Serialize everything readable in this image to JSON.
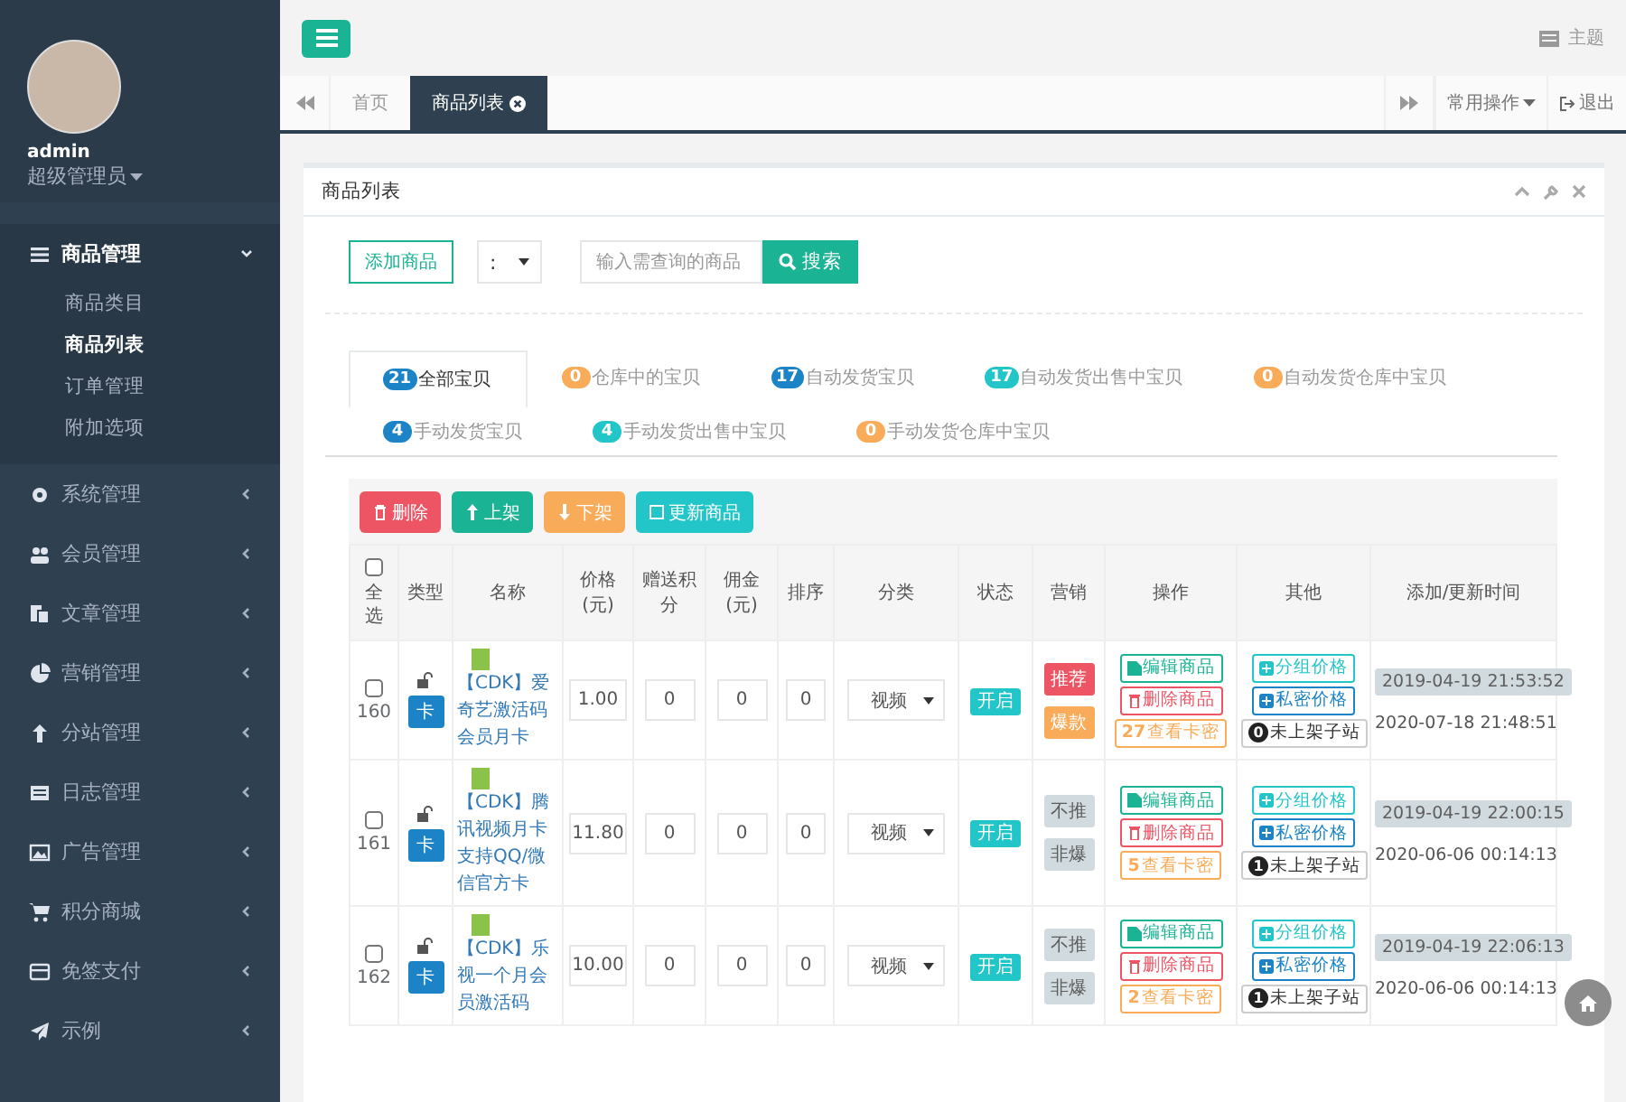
{
  "sidebar": {
    "user": {
      "name": "admin",
      "role": "超级管理员"
    },
    "menu": [
      {
        "label": "商品管理",
        "expanded": true,
        "children": [
          {
            "label": "商品类目",
            "selected": false
          },
          {
            "label": "商品列表",
            "selected": true
          },
          {
            "label": "订单管理",
            "selected": false
          },
          {
            "label": "附加选项",
            "selected": false
          }
        ]
      },
      {
        "label": "系统管理",
        "expanded": false
      },
      {
        "label": "会员管理",
        "expanded": false
      },
      {
        "label": "文章管理",
        "expanded": false
      },
      {
        "label": "营销管理",
        "expanded": false
      },
      {
        "label": "分站管理",
        "expanded": false
      },
      {
        "label": "日志管理",
        "expanded": false
      },
      {
        "label": "广告管理",
        "expanded": false
      },
      {
        "label": "积分商城",
        "expanded": false
      },
      {
        "label": "免签支付",
        "expanded": false
      },
      {
        "label": "示例",
        "expanded": false
      }
    ]
  },
  "topbar": {
    "theme_label": "主题"
  },
  "page_tabs": [
    {
      "label": "首页",
      "selected": false
    },
    {
      "label": "商品列表",
      "selected": true
    }
  ],
  "tab_actions": {
    "common_ops": "常用操作",
    "logout": "退出"
  },
  "panel": {
    "title": "商品列表",
    "add_button": "添加商品",
    "filter_select": ":",
    "search": {
      "placeholder": "输入需查询的商品"
    },
    "search_button": "搜索",
    "status_tabs": [
      {
        "count": "21",
        "label": "全部宝贝",
        "color": "#1c84c6",
        "selected": true
      },
      {
        "count": "0",
        "label": "仓库中的宝贝",
        "color": "#f8ac59",
        "selected": false
      },
      {
        "count": "17",
        "label": "自动发货宝贝",
        "color": "#1c84c6",
        "selected": false
      },
      {
        "count": "17",
        "label": "自动发货出售中宝贝",
        "color": "#23c6c8",
        "selected": false
      },
      {
        "count": "0",
        "label": "自动发货仓库中宝贝",
        "color": "#f8ac59",
        "selected": false
      },
      {
        "count": "4",
        "label": "手动发货宝贝",
        "color": "#1c84c6",
        "selected": false
      },
      {
        "count": "4",
        "label": "手动发货出售中宝贝",
        "color": "#23c6c8",
        "selected": false
      },
      {
        "count": "0",
        "label": "手动发货仓库中宝贝",
        "color": "#f8ac59",
        "selected": false
      }
    ],
    "bulk_actions": [
      {
        "label": "删除",
        "color": "#ed5565"
      },
      {
        "label": "上架",
        "color": "#1ab394"
      },
      {
        "label": "下架",
        "color": "#f8ac59"
      },
      {
        "label": "更新商品",
        "color": "#23c6c8"
      }
    ],
    "table": {
      "select_all": {
        "label": "全选",
        "checked": false
      },
      "columns": [
        "类型",
        "名称",
        "价格(元)",
        "赠送积分",
        "佣金(元)",
        "排序",
        "分类",
        "状态",
        "营销",
        "操作",
        "其他",
        "添加/更新时间"
      ],
      "rows": [
        {
          "checked": false,
          "id": "160",
          "type": "卡",
          "name": "【CDK】爱奇艺激活码会员月卡",
          "price": "1.00",
          "points": "0",
          "commission": "0",
          "sort": "0",
          "category": "视频",
          "status": "开启",
          "tags": [
            {
              "label": "推荐",
              "color": "#ed5565"
            },
            {
              "label": "爆款",
              "color": "#f8ac59"
            }
          ],
          "edit": "编辑商品",
          "delete": "删除商品",
          "card_count": "27",
          "card_label": "查看卡密",
          "group_price": "分组价格",
          "private_price": "私密价格",
          "sub_count": "0",
          "sub_label": "未上架子站",
          "created": "2019-04-19 21:53:52",
          "updated": "2020-07-18 21:48:51"
        },
        {
          "checked": false,
          "id": "161",
          "type": "卡",
          "name": "【CDK】腾讯视频月卡支持QQ/微信官方卡",
          "price": "11.80",
          "points": "0",
          "commission": "0",
          "sort": "0",
          "category": "视频",
          "status": "开启",
          "tags": [
            {
              "label": "不推",
              "color": "#d1dade"
            },
            {
              "label": "非爆",
              "color": "#d1dade"
            }
          ],
          "edit": "编辑商品",
          "delete": "删除商品",
          "card_count": "5",
          "card_label": "查看卡密",
          "group_price": "分组价格",
          "private_price": "私密价格",
          "sub_count": "1",
          "sub_label": "未上架子站",
          "created": "2019-04-19 22:00:15",
          "updated": "2020-06-06 00:14:13"
        },
        {
          "checked": false,
          "id": "162",
          "type": "卡",
          "name": "【CDK】乐视一个月会员激活码",
          "price": "10.00",
          "points": "0",
          "commission": "0",
          "sort": "0",
          "category": "视频",
          "status": "开启",
          "tags": [
            {
              "label": "不推",
              "color": "#d1dade"
            },
            {
              "label": "非爆",
              "color": "#d1dade"
            }
          ],
          "edit": "编辑商品",
          "delete": "删除商品",
          "card_count": "2",
          "card_label": "查看卡密",
          "group_price": "分组价格",
          "private_price": "私密价格",
          "sub_count": "1",
          "sub_label": "未上架子站",
          "created": "2019-04-19 22:06:13",
          "updated": "2020-06-06 00:14:13"
        }
      ]
    }
  }
}
